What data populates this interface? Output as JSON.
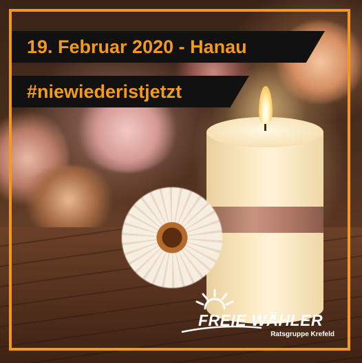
{
  "banner": {
    "date_line": "19. Februar 2020 - Hanau",
    "hashtag": "#niewiederistjetzt"
  },
  "logo": {
    "name": "FREIE WÄHLER",
    "subtitle": "Ratsgruppe Krefeld",
    "icon": "sun-rays-icon"
  },
  "colors": {
    "accent": "#f39a1e",
    "banner_bg": "#111111",
    "logo_text": "#ffffff"
  },
  "scene": {
    "subject": "candle-with-flowers-image"
  }
}
